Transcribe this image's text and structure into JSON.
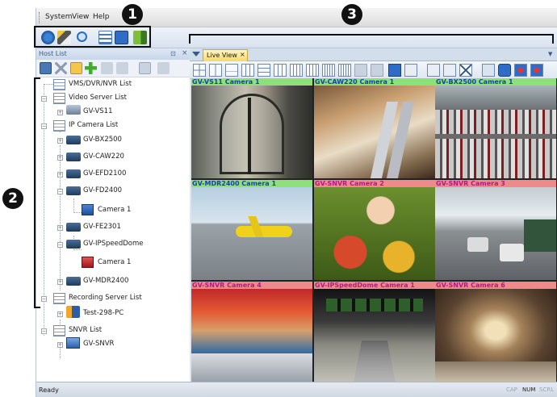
{
  "menu": {
    "system": "System",
    "view": "View",
    "help": "Help"
  },
  "host_list": {
    "title": "Host List",
    "pin_glyph": "⊡",
    "close_glyph": "×",
    "tree": [
      {
        "label": "VMS/DVR/NVR List",
        "icon": "list-icon"
      },
      {
        "label": "Video Server List",
        "icon": "list-icon"
      },
      {
        "label": "GV-VS11",
        "icon": "video-server-icon"
      },
      {
        "label": "IP Camera List",
        "icon": "list-icon"
      },
      {
        "label": "GV-BX2500",
        "icon": "camera-icon"
      },
      {
        "label": "GV-CAW220",
        "icon": "camera-icon"
      },
      {
        "label": "GV-EFD2100",
        "icon": "camera-icon"
      },
      {
        "label": "GV-FD2400",
        "icon": "camera-icon"
      },
      {
        "label": "Camera 1",
        "icon": "channel-icon"
      },
      {
        "label": "GV-FE2301",
        "icon": "camera-icon"
      },
      {
        "label": "GV-IPSpeedDome",
        "icon": "camera-icon"
      },
      {
        "label": "Camera 1",
        "icon": "channel-recording-icon"
      },
      {
        "label": "GV-MDR2400",
        "icon": "camera-icon"
      },
      {
        "label": "Recording Server List",
        "icon": "list-icon"
      },
      {
        "label": "Test-298-PC",
        "icon": "recording-server-icon"
      },
      {
        "label": "SNVR List",
        "icon": "list-icon"
      },
      {
        "label": "GV-SNVR",
        "icon": "snvr-icon"
      }
    ]
  },
  "live_view": {
    "tab_label": "Live View",
    "tab_close": "×",
    "menu_arrow": "▼",
    "cameras": [
      {
        "label": "GV-VS11 Camera 1",
        "label_bg": "#8ee07a",
        "label_color": "#1a3fb0"
      },
      {
        "label": "GV-CAW220 Camera 1",
        "label_bg": "#8ee07a",
        "label_color": "#1a3fb0"
      },
      {
        "label": "GV-BX2500 Camera 1",
        "label_bg": "#8ee07a",
        "label_color": "#1a3fb0"
      },
      {
        "label": "GV-MDR2400 Camera 1",
        "label_bg": "#8ee07a",
        "label_color": "#1a3fb0"
      },
      {
        "label": "GV-SNVR Camera 2",
        "label_bg": "#f08a8a",
        "label_color": "#b01a8a"
      },
      {
        "label": "GV-SNVR Camera 3",
        "label_bg": "#f08a8a",
        "label_color": "#b01a8a"
      },
      {
        "label": "GV-SNVR Camera 4",
        "label_bg": "#f08a8a",
        "label_color": "#b01a8a"
      },
      {
        "label": "GV-IPSpeedDome Camera 1",
        "label_bg": "#f08a8a",
        "label_color": "#b01a8a"
      },
      {
        "label": "GV-SNVR Camera 6",
        "label_bg": "#f08a8a",
        "label_color": "#b01a8a"
      }
    ]
  },
  "status": {
    "text": "Ready",
    "cap": "CAP",
    "num": "NUM",
    "scrl": "SCRL"
  },
  "callouts": {
    "one": "1",
    "two": "2",
    "three": "3"
  }
}
